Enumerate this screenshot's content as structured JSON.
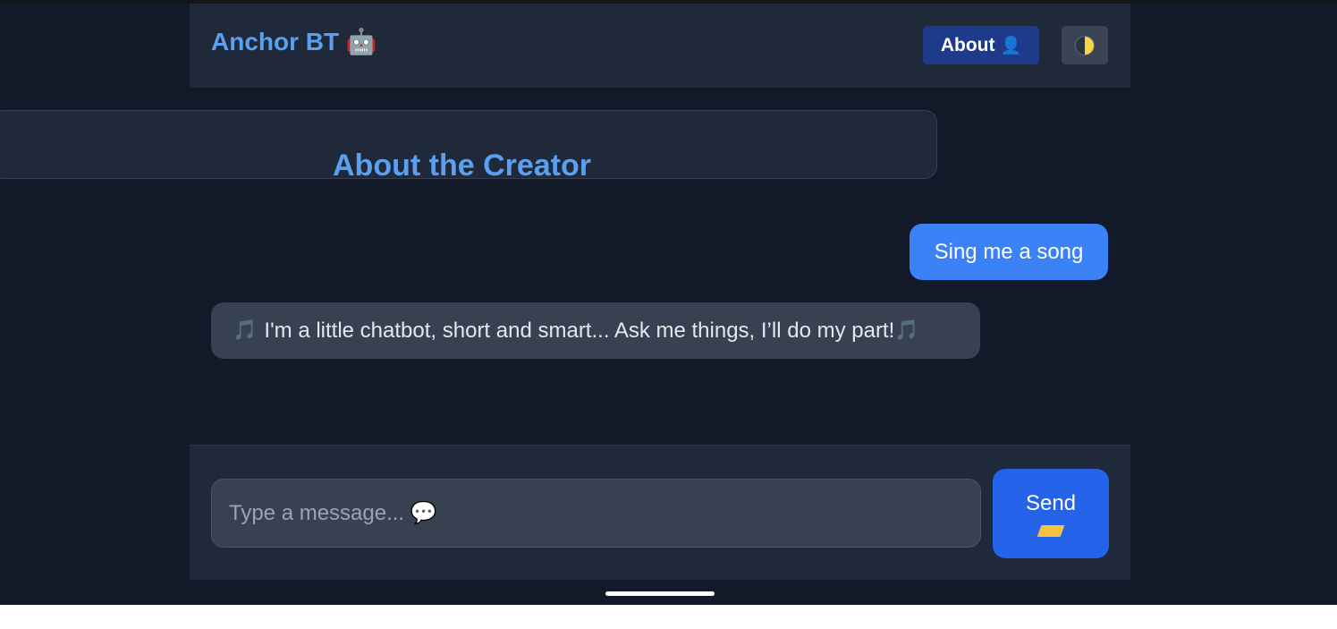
{
  "header": {
    "brand": "Anchor BT",
    "brand_emoji": "🤖",
    "about_label": "About",
    "about_icon": "👤",
    "theme_toggle_icon": "half-moon-icon"
  },
  "about_panel": {
    "title": "About the Creator"
  },
  "messages": [
    {
      "role": "user",
      "text": "Sing me a song"
    },
    {
      "role": "bot",
      "prefix": "🎵",
      "text": "I'm a little chatbot, short and smart... Ask me things, I’ll do my part!",
      "suffix": "🎵"
    }
  ],
  "composer": {
    "placeholder": "Type a message... 💬",
    "value": "",
    "send_label": "Send",
    "send_icon": "envelope-icon"
  },
  "colors": {
    "background": "#121a2a",
    "panel": "#1f2939",
    "accent": "#5aa0f0",
    "user_bubble": "#3b82f6",
    "bot_bubble": "#374151",
    "send_button": "#2563eb"
  }
}
